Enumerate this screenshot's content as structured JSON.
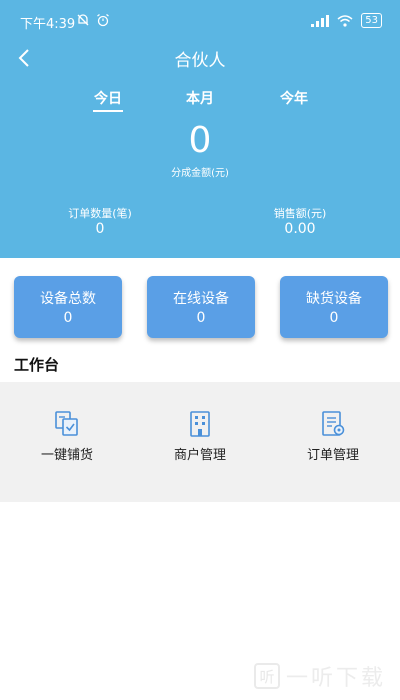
{
  "status_bar": {
    "time": "下午4:39",
    "battery": "53"
  },
  "nav": {
    "title": "合伙人"
  },
  "tabs": [
    {
      "label": "今日"
    },
    {
      "label": "本月"
    },
    {
      "label": "今年"
    }
  ],
  "summary": {
    "amount": "0",
    "amount_label": "分成金额(元)"
  },
  "stats": {
    "orders": {
      "label": "订单数量(笔)",
      "value": "0"
    },
    "sales": {
      "label": "销售额(元)",
      "value": "0.00"
    }
  },
  "device_cards": [
    {
      "label": "设备总数",
      "value": "0"
    },
    {
      "label": "在线设备",
      "value": "0"
    },
    {
      "label": "缺货设备",
      "value": "0"
    }
  ],
  "workbench": {
    "title": "工作台",
    "items": [
      {
        "label": "一键铺货",
        "icon": "restock-icon"
      },
      {
        "label": "商户管理",
        "icon": "building-icon"
      },
      {
        "label": "订单管理",
        "icon": "order-document-icon"
      }
    ]
  },
  "watermark": {
    "logo": "听",
    "text": "一听下载"
  },
  "colors": {
    "header": "#5bb6e3",
    "card": "#5a9fe6",
    "icon": "#4a90d9",
    "workbench_bg": "#f1f1f1"
  }
}
